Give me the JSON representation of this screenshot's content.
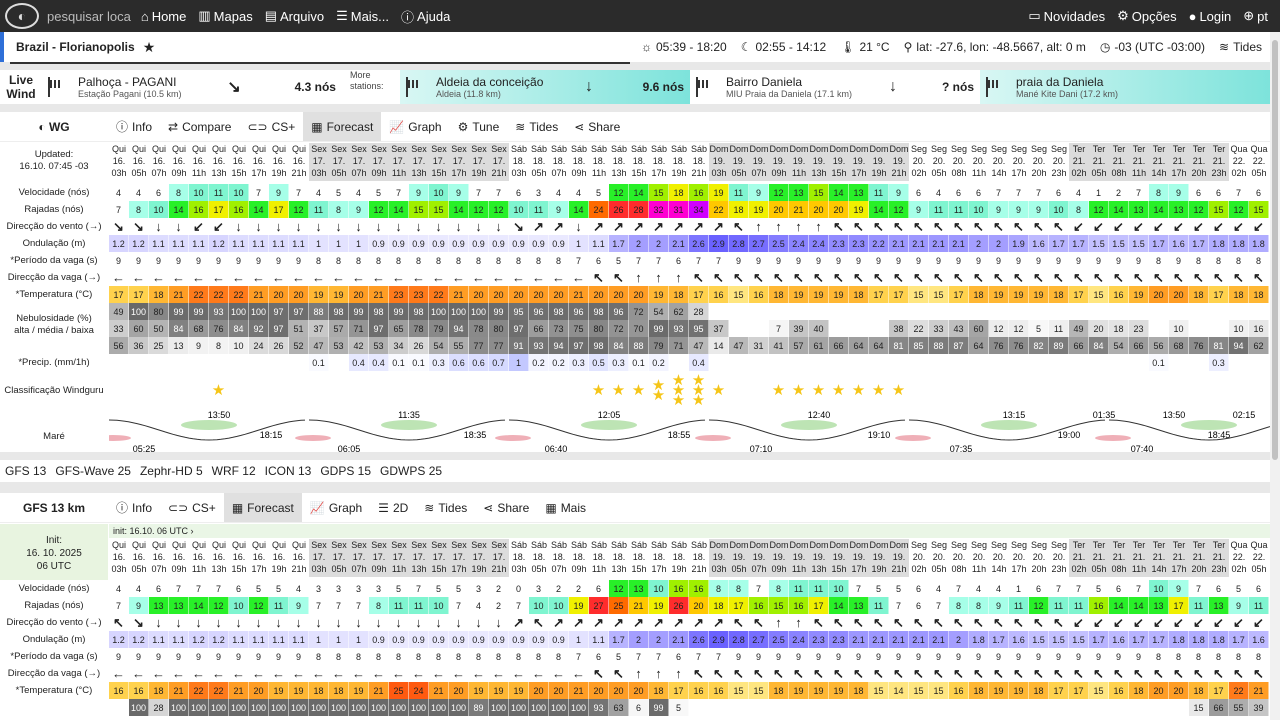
{
  "topbar": {
    "search": "pesquisar loca",
    "home": "Home",
    "maps": "Mapas",
    "archive": "Arquivo",
    "more": "Mais...",
    "help": "Ajuda",
    "news": "Novidades",
    "options": "Opções",
    "login": "Login",
    "lang": "pt"
  },
  "location": {
    "name": "Brazil - Florianopolis",
    "sun": "05:39 - 18:20",
    "moon": "02:55 - 14:12",
    "temp": "21 °C",
    "coords": "lat: -27.6, lon: -48.5667, alt: 0 m",
    "tz": "-03 (UTC -03:00)",
    "tides": "Tides"
  },
  "livewind": {
    "title": "Live Wind",
    "more": "More stations:",
    "stations": [
      {
        "name": "Palhoça - PAGANI",
        "sub": "Estação Pagani (10.5 km)",
        "speed": "4.3 nós",
        "arrow": "↘",
        "hl": false
      },
      {
        "name": "Aldeia da conceição",
        "sub": "Aldeia (11.8 km)",
        "speed": "9.6 nós",
        "arrow": "↓",
        "hl": true
      },
      {
        "name": "Bairro Daniela",
        "sub": "MIU Praia da Daniela (17.1 km)",
        "speed": "? nós",
        "arrow": "↓",
        "hl": false
      },
      {
        "name": "praia da Daniela",
        "sub": "Mané Kite Dani (17.2 km)",
        "speed": "",
        "arrow": "",
        "hl": true
      }
    ]
  },
  "wgtabs": {
    "head": "WG",
    "info": "Info",
    "compare": "Compare",
    "cs": "CS+",
    "forecast": "Forecast",
    "graph": "Graph",
    "tune": "Tune",
    "tides": "Tides",
    "share": "Share"
  },
  "wg": {
    "updated": "Updated:",
    "updated_val": "16.10. 07:45 -03",
    "labels": {
      "speed": "Velocidade (nós)",
      "gusts": "Rajadas (nós)",
      "dir": "Direcção do vento (→)",
      "wave": "Ondulação (m)",
      "period": "*Período da vaga (s)",
      "wavedir": "Direcção da vaga (→)",
      "temp": "*Temperatura (°C)",
      "cloud1": "Nebulosidade (%)",
      "cloud2": "alta / média / baixa",
      "precip": "*Precip. (mm/1h)",
      "rating": "Classificação Windguru",
      "tide": "Maré"
    },
    "days": [
      "Qui",
      "Qui",
      "Qui",
      "Qui",
      "Qui",
      "Qui",
      "Qui",
      "Qui",
      "Qui",
      "Qui",
      "Sex",
      "Sex",
      "Sex",
      "Sex",
      "Sex",
      "Sex",
      "Sex",
      "Sex",
      "Sex",
      "Sex",
      "Sáb",
      "Sáb",
      "Sáb",
      "Sáb",
      "Sáb",
      "Sáb",
      "Sáb",
      "Sáb",
      "Sáb",
      "Sáb",
      "Dom",
      "Dom",
      "Dom",
      "Dom",
      "Dom",
      "Dom",
      "Dom",
      "Dom",
      "Dom",
      "Dom",
      "Seg",
      "Seg",
      "Seg",
      "Seg",
      "Seg",
      "Seg",
      "Seg",
      "Seg",
      "Ter",
      "Ter",
      "Ter",
      "Ter",
      "Ter",
      "Ter",
      "Ter",
      "Ter",
      "Qua",
      "Qua"
    ],
    "dates": [
      "16.",
      "16.",
      "16.",
      "16.",
      "16.",
      "16.",
      "16.",
      "16.",
      "16.",
      "16.",
      "17.",
      "17.",
      "17.",
      "17.",
      "17.",
      "17.",
      "17.",
      "17.",
      "17.",
      "17.",
      "18.",
      "18.",
      "18.",
      "18.",
      "18.",
      "18.",
      "18.",
      "18.",
      "18.",
      "18.",
      "19.",
      "19.",
      "19.",
      "19.",
      "19.",
      "19.",
      "19.",
      "19.",
      "19.",
      "19.",
      "20.",
      "20.",
      "20.",
      "20.",
      "20.",
      "20.",
      "20.",
      "20.",
      "21.",
      "21.",
      "21.",
      "21.",
      "21.",
      "21.",
      "21.",
      "21.",
      "22.",
      "22."
    ],
    "hours": [
      "03h",
      "05h",
      "07h",
      "09h",
      "11h",
      "13h",
      "15h",
      "17h",
      "19h",
      "21h",
      "03h",
      "05h",
      "07h",
      "09h",
      "11h",
      "13h",
      "15h",
      "17h",
      "19h",
      "21h",
      "03h",
      "05h",
      "07h",
      "09h",
      "11h",
      "13h",
      "15h",
      "17h",
      "19h",
      "21h",
      "03h",
      "05h",
      "07h",
      "09h",
      "11h",
      "13h",
      "15h",
      "17h",
      "19h",
      "21h",
      "02h",
      "05h",
      "08h",
      "11h",
      "14h",
      "17h",
      "20h",
      "23h",
      "02h",
      "05h",
      "08h",
      "11h",
      "14h",
      "17h",
      "20h",
      "23h",
      "02h",
      "05h"
    ],
    "speed": [
      4,
      4,
      6,
      8,
      10,
      11,
      10,
      7,
      9,
      7,
      4,
      5,
      4,
      5,
      7,
      9,
      10,
      9,
      7,
      7,
      6,
      3,
      4,
      4,
      5,
      12,
      14,
      15,
      18,
      16,
      19,
      11,
      9,
      12,
      13,
      15,
      14,
      13,
      11,
      9,
      6,
      4,
      6,
      6,
      7,
      7,
      7,
      6,
      4,
      1,
      2,
      7,
      8,
      9,
      6,
      6,
      7,
      6
    ],
    "gusts": [
      7,
      8,
      10,
      14,
      16,
      17,
      16,
      14,
      17,
      12,
      11,
      8,
      9,
      12,
      14,
      15,
      15,
      14,
      12,
      12,
      10,
      11,
      9,
      14,
      24,
      26,
      28,
      32,
      31,
      34,
      22,
      18,
      19,
      20,
      21,
      20,
      20,
      19,
      14,
      12,
      9,
      11,
      11,
      10,
      9,
      9,
      9,
      10,
      8,
      12,
      14,
      13,
      14,
      13,
      12,
      15,
      12,
      15
    ],
    "dir": [
      "↘",
      "↘",
      "↓",
      "↓",
      "↙",
      "↙",
      "↓",
      "↓",
      "↓",
      "↓",
      "↓",
      "↓",
      "↓",
      "↓",
      "↓",
      "↓",
      "↓",
      "↓",
      "↓",
      "↓",
      "↘",
      "↗",
      "↗",
      "↓",
      "↗",
      "↗",
      "↗",
      "↗",
      "↗",
      "↗",
      "↗",
      "↖",
      "↑",
      "↑",
      "↑",
      "↑",
      "↖",
      "↖",
      "↖",
      "↖",
      "↖",
      "↖",
      "↖",
      "↖",
      "↖",
      "↖",
      "↖",
      "↖",
      "↙",
      "↙",
      "↙",
      "↙",
      "↙",
      "↙",
      "↙",
      "↙",
      "↙",
      "↙"
    ],
    "wave": [
      1.2,
      1.2,
      1.1,
      1.1,
      1.1,
      1.2,
      1.1,
      1.1,
      1.1,
      1.1,
      1,
      1,
      1,
      0.9,
      0.9,
      0.9,
      0.9,
      0.9,
      0.9,
      0.9,
      0.9,
      0.9,
      0.9,
      1,
      1.1,
      1.7,
      2,
      2,
      2.1,
      2.6,
      2.9,
      2.8,
      2.7,
      2.5,
      2.4,
      2.4,
      2.3,
      2.3,
      2.2,
      2.1,
      2.1,
      2.1,
      2.1,
      2,
      2,
      1.9,
      1.6,
      1.7,
      1.7,
      1.5,
      1.5,
      1.5,
      1.7,
      1.6,
      1.7,
      1.8,
      1.8,
      1.8
    ],
    "period": [
      9,
      9,
      9,
      9,
      9,
      9,
      9,
      9,
      9,
      9,
      8,
      8,
      8,
      8,
      8,
      8,
      8,
      8,
      8,
      8,
      8,
      8,
      8,
      7,
      6,
      5,
      7,
      7,
      6,
      7,
      7,
      9,
      9,
      9,
      9,
      9,
      9,
      9,
      9,
      9,
      9,
      9,
      9,
      9,
      9,
      9,
      9,
      9,
      9,
      9,
      9,
      9,
      8,
      9,
      8,
      8,
      8,
      8
    ],
    "wavedir": [
      "←",
      "←",
      "←",
      "←",
      "←",
      "←",
      "←",
      "←",
      "←",
      "←",
      "←",
      "←",
      "←",
      "←",
      "←",
      "←",
      "←",
      "←",
      "←",
      "←",
      "←",
      "←",
      "←",
      "←",
      "↖",
      "↖",
      "↑",
      "↑",
      "↑",
      "↖",
      "↖",
      "↖",
      "↖",
      "↖",
      "↖",
      "↖",
      "↖",
      "↖",
      "↖",
      "↖",
      "↖",
      "↖",
      "↖",
      "↖",
      "↖",
      "↖",
      "↖",
      "↖",
      "↖",
      "↖",
      "↖",
      "↖",
      "↖",
      "↖",
      "↖",
      "↖",
      "↖",
      "↖"
    ],
    "temp": [
      17,
      17,
      18,
      21,
      22,
      22,
      22,
      21,
      20,
      20,
      19,
      19,
      20,
      21,
      23,
      23,
      22,
      21,
      20,
      20,
      20,
      20,
      20,
      21,
      20,
      20,
      20,
      19,
      18,
      17,
      16,
      15,
      16,
      18,
      19,
      19,
      19,
      18,
      17,
      17,
      15,
      15,
      17,
      18,
      19,
      19,
      19,
      18,
      17,
      15,
      16,
      19,
      20,
      20,
      18,
      17,
      18,
      18
    ],
    "cloud_h": [
      49,
      100,
      80,
      99,
      99,
      93,
      100,
      100,
      97,
      97,
      88,
      98,
      99,
      98,
      99,
      98,
      100,
      100,
      100,
      99,
      95,
      96,
      98,
      96,
      98,
      96,
      72,
      54,
      62,
      28,
      "",
      "",
      "",
      "",
      "",
      "",
      "",
      "",
      "",
      "",
      "",
      "",
      "",
      "",
      "",
      "",
      "",
      "",
      "",
      "",
      "",
      "",
      "",
      "",
      "",
      "",
      "",
      ""
    ],
    "cloud_m": [
      33,
      60,
      50,
      84,
      68,
      76,
      84,
      92,
      97,
      51,
      37,
      57,
      71,
      97,
      65,
      78,
      79,
      94,
      78,
      80,
      97,
      66,
      73,
      75,
      80,
      72,
      70,
      99,
      93,
      95,
      37,
      "",
      "",
      7,
      39,
      40,
      "",
      "",
      "",
      38,
      22,
      33,
      43,
      60,
      12,
      12,
      5,
      11,
      49,
      20,
      18,
      23,
      "",
      10,
      "",
      "",
      10,
      16
    ],
    "cloud_l": [
      56,
      36,
      25,
      13,
      9,
      8,
      10,
      24,
      26,
      52,
      47,
      53,
      42,
      53,
      34,
      26,
      54,
      55,
      77,
      77,
      91,
      93,
      94,
      97,
      98,
      84,
      88,
      79,
      71,
      47,
      14,
      47,
      31,
      41,
      57,
      61,
      66,
      64,
      64,
      81,
      85,
      88,
      87,
      64,
      76,
      76,
      82,
      89,
      66,
      84,
      54,
      66,
      56,
      68,
      76,
      81,
      94,
      62
    ],
    "precip": [
      "",
      "",
      "",
      "",
      "",
      "",
      "",
      "",
      "",
      "",
      0.1,
      "",
      0.4,
      0.4,
      0.1,
      0.1,
      0.3,
      0.6,
      0.6,
      0.7,
      1,
      0.2,
      0.2,
      0.3,
      0.5,
      0.3,
      0.1,
      0.2,
      "",
      0.4,
      "",
      "",
      "",
      "",
      "",
      "",
      "",
      "",
      "",
      "",
      "",
      "",
      "",
      "",
      "",
      "",
      "",
      "",
      "",
      "",
      "",
      "",
      0.1,
      "",
      "",
      0.3,
      "",
      ""
    ],
    "stars": [
      0,
      0,
      0,
      0,
      0,
      1,
      0,
      0,
      0,
      0,
      0,
      0,
      0,
      0,
      0,
      0,
      0,
      0,
      0,
      0,
      0,
      0,
      0,
      0,
      1,
      1,
      1,
      2,
      3,
      3,
      1,
      0,
      0,
      1,
      1,
      1,
      1,
      1,
      1,
      1,
      0,
      0,
      0,
      0,
      0,
      0,
      0,
      0,
      0,
      0,
      0,
      0,
      0,
      0,
      0,
      0,
      0,
      0
    ],
    "tides": {
      "high": [
        "13:50",
        "11:35",
        "12:05",
        "12:40",
        "13:15",
        "01:35",
        "13:50",
        "02:15"
      ],
      "low": [
        "05:25",
        "18:15",
        "06:05",
        "18:35",
        "06:40",
        "18:55",
        "07:10",
        "19:10",
        "07:35",
        "19:00",
        "07:40",
        "18:45"
      ]
    }
  },
  "models": [
    "GFS 13",
    "GFS-Wave 25",
    "Zephr-HD 5",
    "WRF 12",
    "ICON 13",
    "GDPS 15",
    "GDWPS 25"
  ],
  "gfstabs": {
    "head": "GFS 13 km",
    "info": "Info",
    "cs": "CS+",
    "forecast": "Forecast",
    "graph": "Graph",
    "d2": "2D",
    "tides": "Tides",
    "share": "Share",
    "more": "Mais"
  },
  "gfs": {
    "init_label": "Init:",
    "init_date": "16. 10. 2025",
    "init_utc": "06 UTC",
    "initbar": "init: 16.10. 06 UTC ›",
    "days": [
      "Qui",
      "Qui",
      "Qui",
      "Qui",
      "Qui",
      "Qui",
      "Qui",
      "Qui",
      "Qui",
      "Qui",
      "Sex",
      "Sex",
      "Sex",
      "Sex",
      "Sex",
      "Sex",
      "Sex",
      "Sex",
      "Sex",
      "Sex",
      "Sáb",
      "Sáb",
      "Sáb",
      "Sáb",
      "Sáb",
      "Sáb",
      "Sáb",
      "Sáb",
      "Sáb",
      "Sáb",
      "Dom",
      "Dom",
      "Dom",
      "Dom",
      "Dom",
      "Dom",
      "Dom",
      "Dom",
      "Dom",
      "Dom",
      "Seg",
      "Seg",
      "Seg",
      "Seg",
      "Seg",
      "Seg",
      "Seg",
      "Seg",
      "Ter",
      "Ter",
      "Ter",
      "Ter",
      "Ter",
      "Ter",
      "Ter",
      "Ter",
      "Qua",
      "Qua"
    ],
    "dates": [
      "16.",
      "16.",
      "16.",
      "16.",
      "16.",
      "16.",
      "16.",
      "16.",
      "16.",
      "16.",
      "17.",
      "17.",
      "17.",
      "17.",
      "17.",
      "17.",
      "17.",
      "17.",
      "17.",
      "17.",
      "18.",
      "18.",
      "18.",
      "18.",
      "18.",
      "18.",
      "18.",
      "18.",
      "18.",
      "18.",
      "19.",
      "19.",
      "19.",
      "19.",
      "19.",
      "19.",
      "19.",
      "19.",
      "19.",
      "19.",
      "20.",
      "20.",
      "20.",
      "20.",
      "20.",
      "20.",
      "20.",
      "20.",
      "21.",
      "21.",
      "21.",
      "21.",
      "21.",
      "21.",
      "21.",
      "21.",
      "22.",
      "22."
    ],
    "hours": [
      "03h",
      "05h",
      "07h",
      "09h",
      "11h",
      "13h",
      "15h",
      "17h",
      "19h",
      "21h",
      "03h",
      "05h",
      "07h",
      "09h",
      "11h",
      "13h",
      "15h",
      "17h",
      "19h",
      "21h",
      "03h",
      "05h",
      "07h",
      "09h",
      "11h",
      "13h",
      "15h",
      "17h",
      "19h",
      "21h",
      "03h",
      "05h",
      "07h",
      "09h",
      "11h",
      "13h",
      "15h",
      "17h",
      "19h",
      "21h",
      "02h",
      "05h",
      "08h",
      "11h",
      "14h",
      "17h",
      "20h",
      "23h",
      "02h",
      "05h",
      "08h",
      "11h",
      "14h",
      "17h",
      "20h",
      "23h",
      "02h",
      "05h"
    ],
    "speed": [
      4,
      4,
      6,
      7,
      7,
      7,
      6,
      5,
      5,
      4,
      3,
      3,
      3,
      3,
      5,
      7,
      5,
      5,
      3,
      2,
      0,
      3,
      2,
      2,
      6,
      12,
      13,
      10,
      16,
      16,
      8,
      8,
      7,
      8,
      11,
      11,
      10,
      7,
      5,
      5,
      6,
      4,
      7,
      4,
      4,
      1,
      6,
      7,
      7,
      5,
      6,
      7,
      10,
      9,
      7,
      6,
      5,
      6
    ],
    "gusts": [
      7,
      9,
      13,
      13,
      14,
      12,
      10,
      12,
      11,
      9,
      7,
      7,
      7,
      8,
      11,
      11,
      10,
      7,
      4,
      2,
      7,
      10,
      10,
      19,
      27,
      25,
      21,
      19,
      26,
      20,
      18,
      17,
      16,
      15,
      16,
      17,
      14,
      13,
      11,
      7,
      6,
      7,
      8,
      8,
      9,
      11,
      12,
      11,
      11,
      16,
      14,
      14,
      13,
      17,
      11,
      13,
      9,
      11
    ],
    "dir": [
      "↖",
      "↘",
      "↓",
      "↓",
      "↓",
      "↓",
      "↓",
      "↓",
      "↓",
      "↓",
      "↓",
      "↓",
      "↓",
      "↓",
      "↓",
      "↓",
      "↓",
      "↓",
      "↓",
      "↓",
      "↗",
      "↖",
      "↗",
      "↗",
      "↗",
      "↗",
      "↗",
      "↗",
      "↗",
      "↗",
      "↗",
      "↖",
      "↖",
      "↑",
      "↑",
      "↖",
      "↖",
      "↖",
      "↖",
      "↖",
      "↖",
      "↖",
      "↖",
      "↖",
      "↖",
      "↖",
      "↖",
      "↖",
      "↙",
      "↙",
      "↙",
      "↙",
      "↙",
      "↙",
      "↙",
      "↙",
      "↙",
      "↙"
    ],
    "wave": [
      1.2,
      1.2,
      1.1,
      1.1,
      1.2,
      1.2,
      1.1,
      1.1,
      1.1,
      1.1,
      1,
      1,
      1,
      0.9,
      0.9,
      0.9,
      0.9,
      0.9,
      0.9,
      0.9,
      0.9,
      0.9,
      0.9,
      1,
      1.1,
      1.7,
      2,
      2,
      2.1,
      2.6,
      2.9,
      2.8,
      2.7,
      2.5,
      2.4,
      2.3,
      2.3,
      2.1,
      2.1,
      2.1,
      2.1,
      2.1,
      2,
      1.8,
      1.7,
      1.6,
      1.5,
      1.5,
      1.5,
      1.7,
      1.6,
      1.7,
      1.7,
      1.8,
      1.8,
      1.8,
      1.7,
      1.6
    ],
    "period": [
      9,
      9,
      9,
      9,
      9,
      9,
      9,
      9,
      9,
      9,
      8,
      8,
      8,
      8,
      8,
      8,
      8,
      8,
      8,
      8,
      8,
      8,
      8,
      7,
      6,
      5,
      7,
      7,
      6,
      7,
      7,
      9,
      9,
      9,
      9,
      9,
      9,
      9,
      9,
      9,
      9,
      9,
      9,
      9,
      9,
      9,
      9,
      9,
      9,
      9,
      9,
      9,
      8,
      8,
      8,
      8,
      8,
      8
    ],
    "wavedir": [
      "←",
      "←",
      "←",
      "←",
      "←",
      "←",
      "←",
      "←",
      "←",
      "←",
      "←",
      "←",
      "←",
      "←",
      "←",
      "←",
      "←",
      "←",
      "←",
      "←",
      "←",
      "←",
      "←",
      "←",
      "↖",
      "↖",
      "↑",
      "↑",
      "↑",
      "↖",
      "↖",
      "↖",
      "↖",
      "↖",
      "↖",
      "↖",
      "↖",
      "↖",
      "↖",
      "↖",
      "↖",
      "↖",
      "↖",
      "↖",
      "↖",
      "↖",
      "↖",
      "↖",
      "↖",
      "↖",
      "↖",
      "↖",
      "↖",
      "↖",
      "↖",
      "↖",
      "↖",
      "↖"
    ],
    "temp": [
      16,
      16,
      18,
      21,
      22,
      22,
      21,
      20,
      19,
      19,
      18,
      18,
      19,
      21,
      25,
      24,
      21,
      20,
      19,
      19,
      19,
      20,
      20,
      21,
      20,
      20,
      20,
      18,
      17,
      16,
      16,
      15,
      15,
      18,
      19,
      19,
      19,
      18,
      15,
      14,
      15,
      15,
      16,
      18,
      19,
      19,
      18,
      17,
      17,
      15,
      16,
      18,
      20,
      20,
      18,
      17,
      22,
      21
    ],
    "cloud_h": [
      "",
      100,
      28,
      100,
      100,
      100,
      100,
      100,
      100,
      100,
      100,
      100,
      100,
      100,
      100,
      100,
      100,
      100,
      89,
      100,
      100,
      100,
      100,
      100,
      93,
      63,
      6,
      99,
      5,
      "",
      "",
      "",
      "",
      "",
      "",
      "",
      "",
      "",
      "",
      "",
      "",
      "",
      "",
      "",
      "",
      "",
      "",
      "",
      "",
      "",
      "",
      "",
      "",
      "",
      15,
      66,
      55,
      39
    ]
  },
  "colors": {
    "accent": "#2e6fd8",
    "star": "#f5c518",
    "tideHigh": "#7cc96a",
    "tideLow": "#e06070"
  }
}
